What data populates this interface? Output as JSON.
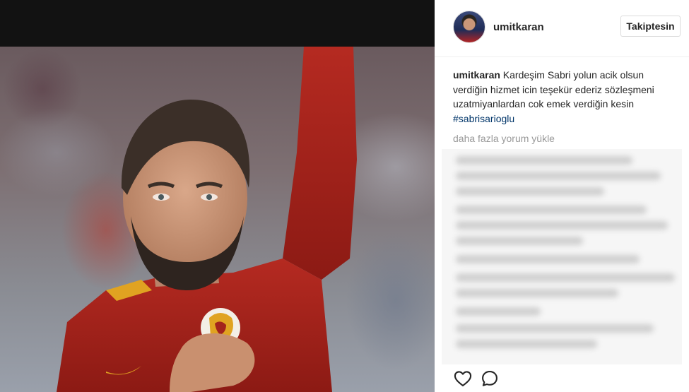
{
  "post": {
    "username": "umitkaran",
    "follow_label": "Takiptesin",
    "caption": {
      "username": "umitkaran",
      "text": " Kardeşim Sabri yolun acik olsun verdiğin hizmet icin teşekür ederiz sözleşmeni uzatmiyanlardan cok emek verdiğin kesin ",
      "hashtag": "#sabrisarioglu"
    },
    "load_more_label": "daha fazla yorum yükle"
  },
  "icons": {
    "avatar": "avatar",
    "like": "heart-icon",
    "comment": "comment-icon"
  },
  "colors": {
    "jersey": "#a3231c",
    "hashtag": "#003569",
    "muted": "#999999"
  }
}
